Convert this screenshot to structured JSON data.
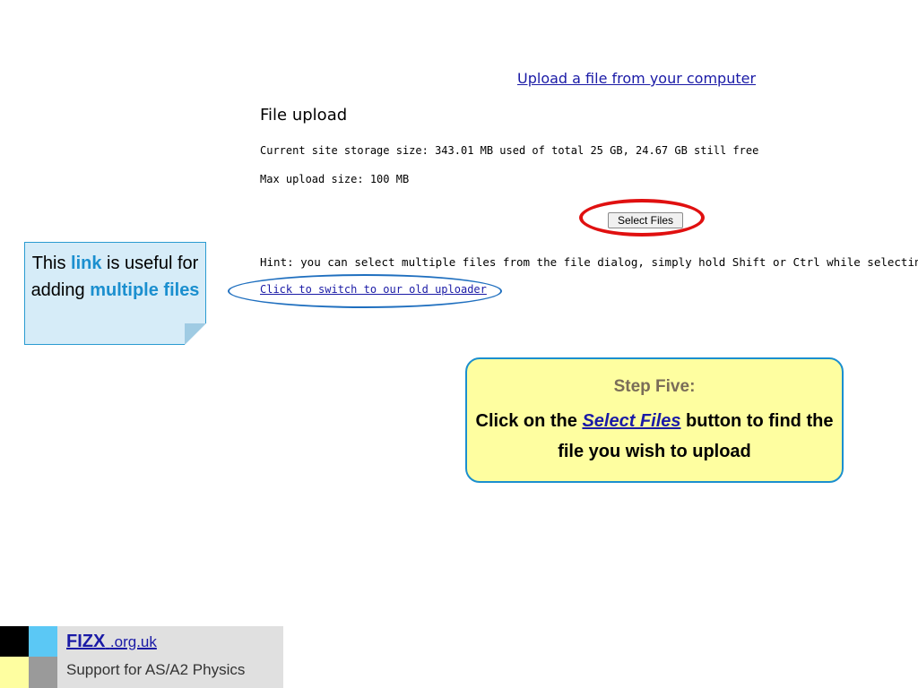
{
  "upload_link": "Upload a file from your computer",
  "section_title": "File upload",
  "storage_info": "Current site storage size: 343.01 MB used of total 25 GB, 24.67 GB still free",
  "max_upload": "Max upload size: 100 MB",
  "select_files_button": "Select Files",
  "hint": "Hint: you can select multiple files from the file dialog, simply hold Shift or Ctrl while selecting.",
  "old_uploader_link": "Click to switch to our old uploader",
  "note": {
    "prefix": "This ",
    "link_word": "link",
    "middle": " is useful for adding ",
    "highlight": "multiple files"
  },
  "step": {
    "heading": "Step Five:",
    "pre": "Click on the ",
    "keyword": "Select Files",
    "post": " button to find the file you wish to upload"
  },
  "footer": {
    "brand_strong": "FIZX",
    "brand_suffix": ".org.uk",
    "tagline": "Support for AS/A2 Physics"
  },
  "colors": {
    "highlight_ring": "#e01010",
    "link_ring": "#1f6fbf",
    "note_bg": "#d6ecf8",
    "step_bg": "#fefea0",
    "accent_blue": "#1b8fcf"
  }
}
